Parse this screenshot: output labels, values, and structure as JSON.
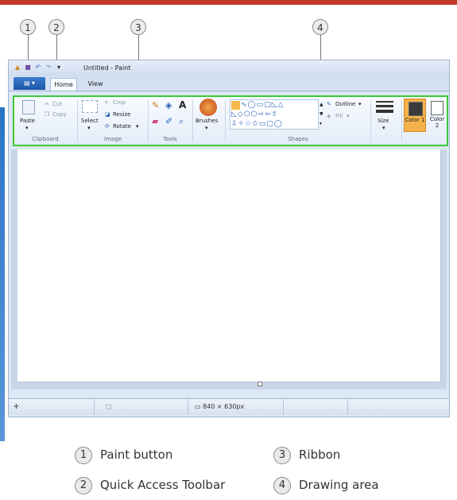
{
  "callouts": [
    "1",
    "2",
    "3",
    "4"
  ],
  "window": {
    "title": "Untitled - Paint",
    "paint_button_icon": "paint-menu-icon",
    "tabs": [
      {
        "label": "Home"
      },
      {
        "label": "View"
      }
    ]
  },
  "ribbon": {
    "clipboard": {
      "title": "Clipboard",
      "paste": "Paste",
      "cut": "Cut",
      "copy": "Copy"
    },
    "image": {
      "title": "Image",
      "select": "Select",
      "crop": "Crop",
      "resize": "Resize",
      "rotate": "Rotate"
    },
    "tools": {
      "title": "Tools"
    },
    "brushes": {
      "label": "Brushes"
    },
    "shapes": {
      "title": "Shapes",
      "outline": "Outline",
      "fill": "Fill"
    },
    "size": {
      "label": "Size"
    },
    "colors": {
      "color1": "Color 1",
      "color2": "Color 2",
      "color1_value": "#3a3a3a",
      "color2_value": "#ffffff"
    }
  },
  "status": {
    "dimensions": "840 × 630px"
  },
  "legend": [
    {
      "num": "1",
      "text": "Paint button"
    },
    {
      "num": "2",
      "text": "Quick Access Toolbar"
    },
    {
      "num": "3",
      "text": "Ribbon"
    },
    {
      "num": "4",
      "text": "Drawing area"
    }
  ],
  "colors": {
    "ribbon_highlight": "#3cc83c",
    "accent": "#1b57a6",
    "frame_red": "#c0392b"
  }
}
